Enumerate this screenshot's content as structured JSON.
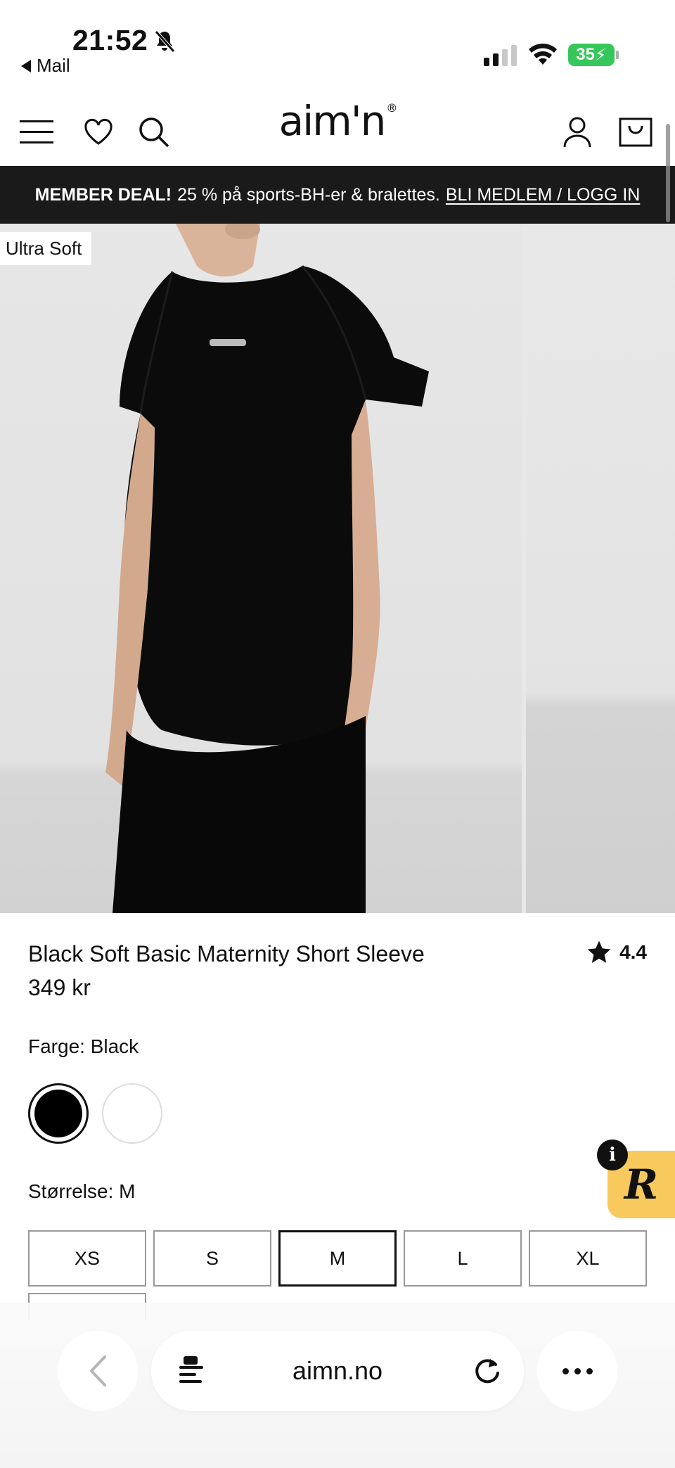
{
  "status_bar": {
    "time": "21:52",
    "back_app": "Mail",
    "battery": "35"
  },
  "header": {
    "logo": "aim'n",
    "icons": [
      "menu-icon",
      "heart-icon",
      "search-icon",
      "account-icon",
      "cart-icon"
    ]
  },
  "promo": {
    "bold": "MEMBER DEAL!",
    "text": "25 % på sports-BH-er & bralettes.",
    "link": "BLI MEDLEM / LOGG IN"
  },
  "gallery": {
    "tag": "Ultra Soft"
  },
  "product": {
    "title": "Black Soft Basic Maternity Short Sleeve",
    "price": "349 kr",
    "rating": "4.4",
    "color_label": "Farge: Black",
    "colors": [
      "#000000",
      "#ffffff"
    ],
    "size_label": "Størrelse: M",
    "sizes": [
      "XS",
      "S",
      "M",
      "L",
      "XL"
    ],
    "selected_size": "M"
  },
  "widget": {
    "info": "i",
    "letter": "R"
  },
  "browser": {
    "url": "aimn.no"
  }
}
